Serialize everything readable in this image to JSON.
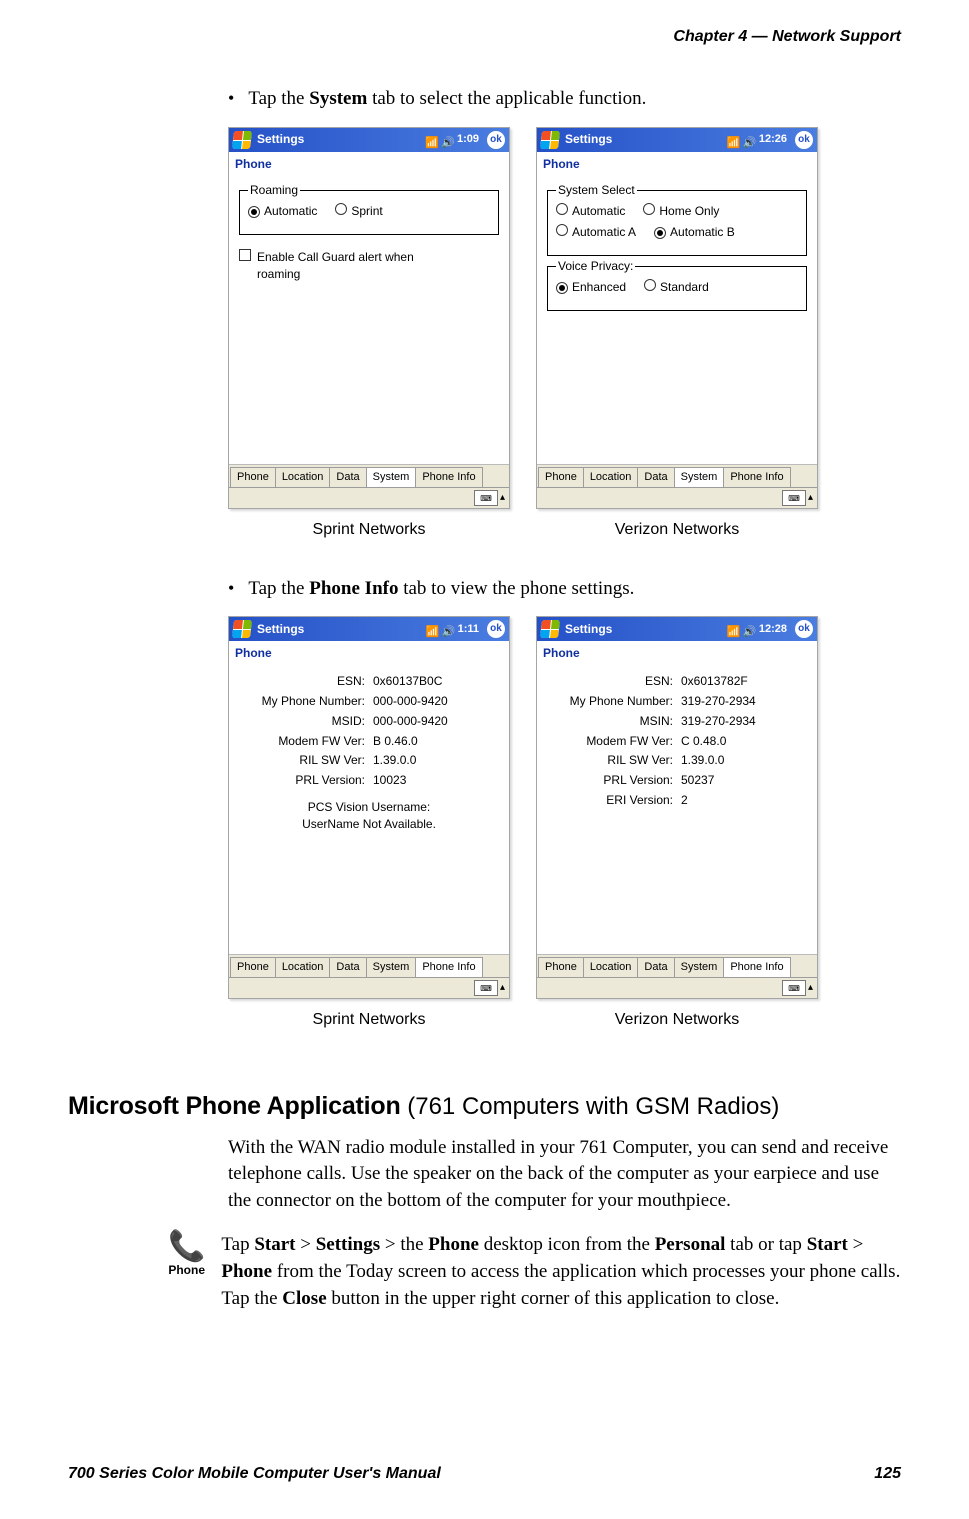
{
  "header": {
    "chapter": "Chapter  4  —  Network Support"
  },
  "bullets": {
    "b1_pre": "Tap the ",
    "b1_bold": "System",
    "b1_post": " tab to select the applicable function.",
    "b2_pre": "Tap the ",
    "b2_bold": "Phone Info",
    "b2_post": " tab to view the phone settings."
  },
  "captions": {
    "sprint": "Sprint Networks",
    "verizon": "Verizon Networks"
  },
  "titlebar": {
    "app": "Settings",
    "ok": "ok"
  },
  "subtitle": "Phone",
  "shot1L": {
    "clock": "1:09",
    "roaming_legend": "Roaming",
    "opt_auto": "Automatic",
    "opt_sprint": "Sprint",
    "cb_label": "Enable Call Guard alert when roaming",
    "tabs": [
      "Phone",
      "Location",
      "Data",
      "System",
      "Phone Info"
    ],
    "active_tab_index": 3
  },
  "shot1R": {
    "clock": "12:26",
    "sysselect_legend": "System Select",
    "opt_auto": "Automatic",
    "opt_home": "Home Only",
    "opt_autoA": "Automatic A",
    "opt_autoB": "Automatic B",
    "voice_legend": "Voice Privacy:",
    "opt_enh": "Enhanced",
    "opt_std": "Standard",
    "tabs": [
      "Phone",
      "Location",
      "Data",
      "System",
      "Phone Info"
    ],
    "active_tab_index": 3
  },
  "shot2L": {
    "clock": "1:11",
    "rows": {
      "esn_k": "ESN:",
      "esn_v": "0x60137B0C",
      "mpn_k": "My Phone Number:",
      "mpn_v": "000-000-9420",
      "msid_k": "MSID:",
      "msid_v": "000-000-9420",
      "fw_k": "Modem FW Ver:",
      "fw_v": "B 0.46.0",
      "ril_k": "RIL SW Ver:",
      "ril_v": "1.39.0.0",
      "prl_k": "PRL Version:",
      "prl_v": "10023"
    },
    "pcs_label": "PCS Vision Username:",
    "pcs_value": "UserName Not Available.",
    "tabs": [
      "Phone",
      "Location",
      "Data",
      "System",
      "Phone Info"
    ],
    "active_tab_index": 4
  },
  "shot2R": {
    "clock": "12:28",
    "rows": {
      "esn_k": "ESN:",
      "esn_v": "0x6013782F",
      "mpn_k": "My Phone Number:",
      "mpn_v": "319-270-2934",
      "msin_k": "MSIN:",
      "msin_v": "319-270-2934",
      "fw_k": "Modem FW Ver:",
      "fw_v": "C 0.48.0",
      "ril_k": "RIL SW Ver:",
      "ril_v": "1.39.0.0",
      "prl_k": "PRL Version:",
      "prl_v": "50237",
      "eri_k": "ERI Version:",
      "eri_v": "2"
    },
    "tabs": [
      "Phone",
      "Location",
      "Data",
      "System",
      "Phone Info"
    ],
    "active_tab_index": 4
  },
  "section": {
    "h2_bold": "Microsoft Phone Application",
    "h2_rest": " (761 Computers with GSM Radios)",
    "para1": "With the WAN radio module installed in your 761 Computer, you can send and receive telephone calls. Use the speaker on the back of the computer as your earpiece and use the connector on the bottom of the computer for your mouthpiece.",
    "phone_icon_label": "Phone",
    "para2_parts": {
      "t1": "Tap ",
      "b1": "Start",
      "t2": " > ",
      "b2": "Settings",
      "t3": " > the ",
      "b3": "Phone",
      "t4": " desktop icon from the ",
      "b4": "Personal",
      "t5": " tab or tap ",
      "b5": "Start",
      "t6": " > ",
      "b6": "Phone",
      "t7": "  from the Today screen to access the application which processes your phone calls. Tap the ",
      "b7": "Close",
      "t8": " button in the upper right corner of this application to close."
    }
  },
  "footer": {
    "left": "700 Series Color Mobile Computer User's Manual",
    "right": "125"
  }
}
